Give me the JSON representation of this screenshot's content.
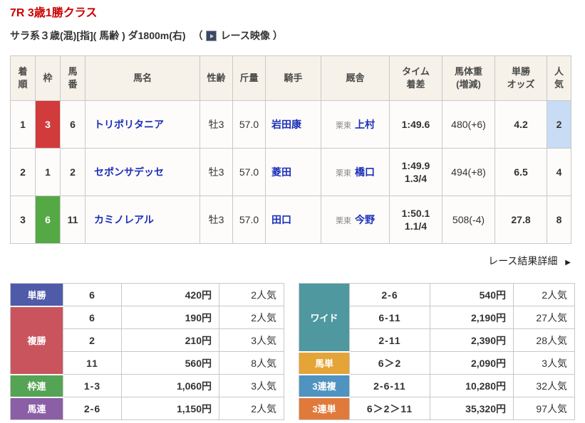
{
  "header": {
    "race_title": "7R 3歳1勝クラス",
    "race_conditions": "サラ系３歳(混)[指]( 馬齢 ) ダ1800m(右)",
    "paren_open": "（",
    "video_label": "レース映像",
    "paren_close": "）",
    "video_icon": "play-video-icon"
  },
  "result_table": {
    "columns": [
      "着\n順",
      "枠",
      "馬\n番",
      "馬名",
      "性齢",
      "斤量",
      "騎手",
      "厩舎",
      "タイム\n着差",
      "馬体重\n(増減)",
      "単勝\nオッズ",
      "人\n気"
    ],
    "rows": [
      {
        "finish": "1",
        "frame": "3",
        "frame_color": "red",
        "number": "6",
        "horse_name": "トリポリタニア",
        "sex_age": "牡3",
        "weight": "57.0",
        "jockey": "岩田康",
        "region": "栗東",
        "trainer": "上村",
        "time": "1:49.6",
        "margin": "",
        "body_weight": "480(+6)",
        "odds": "4.2",
        "popularity": "2",
        "popularity_highlight": true
      },
      {
        "finish": "2",
        "frame": "1",
        "frame_color": "white",
        "number": "2",
        "horse_name": "セポンサデッセ",
        "sex_age": "牡3",
        "weight": "57.0",
        "jockey": "菱田",
        "region": "栗東",
        "trainer": "橋口",
        "time": "1:49.9",
        "margin": "1.3/4",
        "body_weight": "494(+8)",
        "odds": "6.5",
        "popularity": "4",
        "popularity_highlight": false
      },
      {
        "finish": "3",
        "frame": "6",
        "frame_color": "green",
        "number": "11",
        "horse_name": "カミノレアル",
        "sex_age": "牡3",
        "weight": "57.0",
        "jockey": "田口",
        "region": "栗東",
        "trainer": "今野",
        "time": "1:50.1",
        "margin": "1.1/4",
        "body_weight": "508(-4)",
        "odds": "27.8",
        "popularity": "8",
        "popularity_highlight": false
      }
    ]
  },
  "detail_link": {
    "label": "レース結果詳細",
    "arrow": "▶"
  },
  "payouts_left": {
    "groups": [
      {
        "label": "単勝",
        "color": "#4f5aa8",
        "rows": [
          {
            "combo": "6",
            "payout": "420円",
            "pop": "2人気"
          }
        ]
      },
      {
        "label": "複勝",
        "color": "#c9545e",
        "rows": [
          {
            "combo": "6",
            "payout": "190円",
            "pop": "2人気"
          },
          {
            "combo": "2",
            "payout": "210円",
            "pop": "3人気"
          },
          {
            "combo": "11",
            "payout": "560円",
            "pop": "8人気"
          }
        ]
      },
      {
        "label": "枠連",
        "color": "#55a455",
        "rows": [
          {
            "combo": "1-3",
            "payout": "1,060円",
            "pop": "3人気"
          }
        ]
      },
      {
        "label": "馬連",
        "color": "#8a5fa5",
        "rows": [
          {
            "combo": "2-6",
            "payout": "1,150円",
            "pop": "2人気"
          }
        ]
      }
    ]
  },
  "payouts_right": {
    "groups": [
      {
        "label": "ワイド",
        "color": "#4f98a0",
        "rows": [
          {
            "combo": "2-6",
            "payout": "540円",
            "pop": "2人気"
          },
          {
            "combo": "6-11",
            "payout": "2,190円",
            "pop": "27人気"
          },
          {
            "combo": "2-11",
            "payout": "2,390円",
            "pop": "28人気"
          }
        ]
      },
      {
        "label": "馬単",
        "color": "#e5a437",
        "rows": [
          {
            "combo": "6＞2",
            "payout": "2,090円",
            "pop": "3人気"
          }
        ]
      },
      {
        "label": "3連複",
        "color": "#4f93c0",
        "rows": [
          {
            "combo": "2-6-11",
            "payout": "10,280円",
            "pop": "32人気"
          }
        ]
      },
      {
        "label": "3連単",
        "color": "#e07a3a",
        "rows": [
          {
            "combo": "6＞2＞11",
            "payout": "35,320円",
            "pop": "97人気"
          }
        ]
      }
    ]
  },
  "colors": {
    "title_red": "#cc0000",
    "table_header_bg": "#f6f2ea",
    "border": "#c8c8c8",
    "link_blue": "#1b2fb8",
    "frame_3_red": "#d23b3b",
    "frame_6_green": "#55a944",
    "popularity_highlight_blue": "#c9dcf5"
  }
}
